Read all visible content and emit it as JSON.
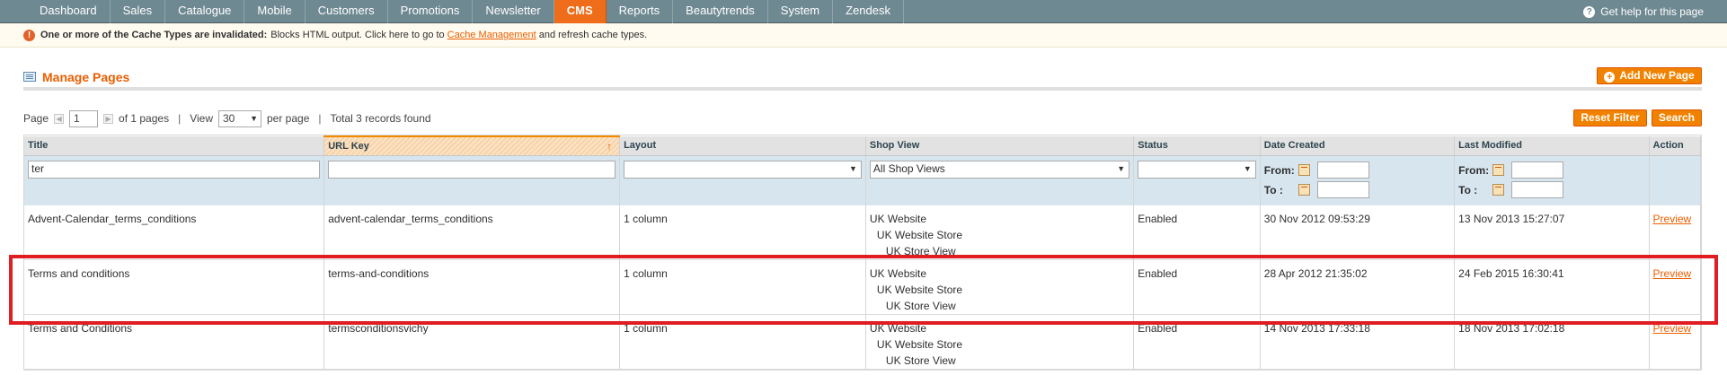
{
  "nav": {
    "items": [
      "Dashboard",
      "Sales",
      "Catalogue",
      "Mobile",
      "Customers",
      "Promotions",
      "Newsletter",
      "CMS",
      "Reports",
      "Beautytrends",
      "System",
      "Zendesk"
    ],
    "active": "CMS",
    "help": "Get help for this page"
  },
  "message": {
    "bold": "One or more of the Cache Types are invalidated:",
    "text1": "Blocks HTML output. Click here to go to",
    "link": "Cache Management",
    "text2": "and refresh cache types."
  },
  "header": {
    "title": "Manage Pages",
    "add_button": "Add New Page"
  },
  "pager": {
    "page_label": "Page",
    "page_value": "1",
    "of_pages": "of 1 pages",
    "view_label": "View",
    "per_page_value": "30",
    "per_page_label": "per page",
    "total": "Total 3 records found"
  },
  "actions": {
    "reset": "Reset Filter",
    "search": "Search"
  },
  "columns": [
    "Title",
    "URL Key",
    "Layout",
    "Shop View",
    "Status",
    "Date Created",
    "Last Modified",
    "Action"
  ],
  "sorted_column": "URL Key",
  "filters": {
    "title": "ter",
    "url_key": "",
    "layout": "",
    "shop_view": "All Shop Views",
    "status": "",
    "from_label": "From:",
    "to_label": "To :"
  },
  "rows": [
    {
      "title": "Advent-Calendar_terms_conditions",
      "url_key": "advent-calendar_terms_conditions",
      "layout": "1 column",
      "website": "UK Website",
      "store": "UK Website Store",
      "store_view": "UK Store View",
      "status": "Enabled",
      "created": "30 Nov 2012 09:53:29",
      "modified": "13 Nov 2013 15:27:07",
      "action": "Preview"
    },
    {
      "title": "Terms and conditions",
      "url_key": "terms-and-conditions",
      "layout": "1 column",
      "website": "UK Website",
      "store": "UK Website Store",
      "store_view": "UK Store View",
      "status": "Enabled",
      "created": "28 Apr 2012 21:35:02",
      "modified": "24 Feb 2015 16:30:41",
      "action": "Preview"
    },
    {
      "title": "Terms and Conditions",
      "url_key": "termsconditionsvichy",
      "layout": "1 column",
      "website": "UK Website",
      "store": "UK Website Store",
      "store_view": "UK Store View",
      "status": "Enabled",
      "created": "14 Nov 2013 17:33:18",
      "modified": "18 Nov 2013 17:02:18",
      "action": "Preview"
    }
  ]
}
